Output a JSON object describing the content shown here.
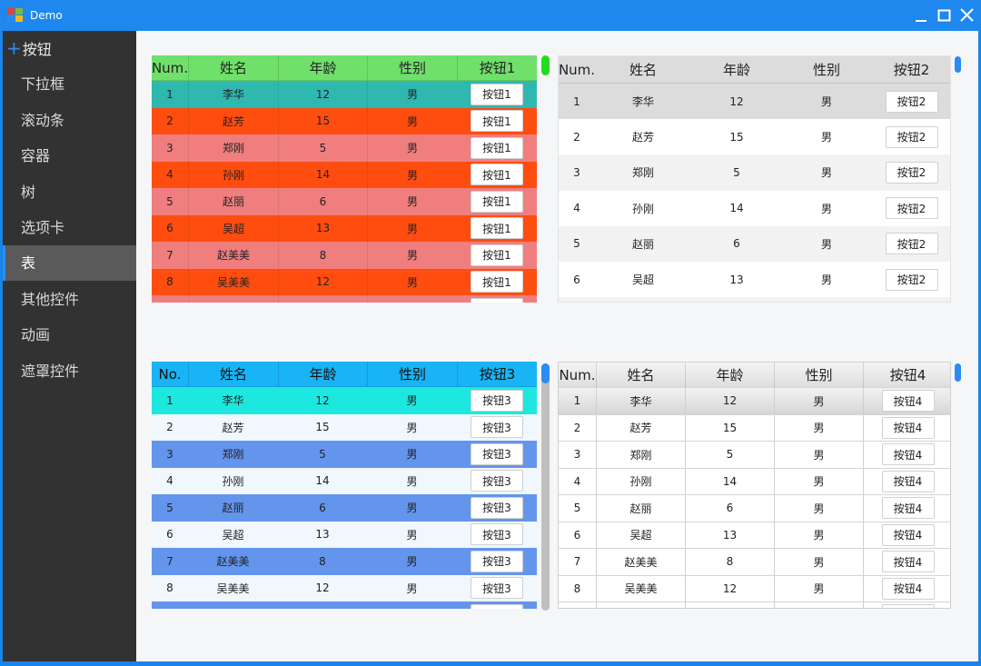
{
  "window": {
    "title": "Demo"
  },
  "sidebar": {
    "items": [
      {
        "label": "按钮",
        "head": true
      },
      {
        "label": "下拉框"
      },
      {
        "label": "滚动条"
      },
      {
        "label": "容器"
      },
      {
        "label": "树"
      },
      {
        "label": "选项卡"
      },
      {
        "label": "表",
        "active": true
      },
      {
        "label": "其他控件"
      },
      {
        "label": "动画"
      },
      {
        "label": "遮罩控件"
      }
    ]
  },
  "people": [
    {
      "num": "1",
      "name": "李华",
      "age": "12",
      "sex": "男"
    },
    {
      "num": "2",
      "name": "赵芳",
      "age": "15",
      "sex": "男"
    },
    {
      "num": "3",
      "name": "郑刚",
      "age": "5",
      "sex": "男"
    },
    {
      "num": "4",
      "name": "孙刚",
      "age": "14",
      "sex": "男"
    },
    {
      "num": "5",
      "name": "赵丽",
      "age": "6",
      "sex": "男"
    },
    {
      "num": "6",
      "name": "吴超",
      "age": "13",
      "sex": "男"
    },
    {
      "num": "7",
      "name": "赵美美",
      "age": "8",
      "sex": "男"
    },
    {
      "num": "8",
      "name": "吴美美",
      "age": "12",
      "sex": "男"
    }
  ],
  "grids": [
    {
      "id": "grid1",
      "headers": [
        "Num.",
        "姓名",
        "年龄",
        "性别",
        "按钮1"
      ],
      "button_label": "按钮1",
      "colors": {
        "header": "#6fe06a",
        "first_row": "#2fb8b0",
        "odd": "#f07e7e",
        "even": "#ff4d10",
        "scroll": "#22dd22"
      }
    },
    {
      "id": "grid2",
      "headers": [
        "Num.",
        "姓名",
        "年龄",
        "性别",
        "按钮2"
      ],
      "button_label": "按钮2",
      "colors": {
        "header": "#dcdcdc",
        "first_row": "#dcdcdc",
        "odd": "#f0f0f0",
        "even": "#ffffff",
        "scroll": "#2a8cf0"
      }
    },
    {
      "id": "grid3",
      "headers": [
        "No.",
        "姓名",
        "年龄",
        "性别",
        "按钮3"
      ],
      "button_label": "按钮3",
      "colors": {
        "header": "#18b4f5",
        "first_row": "#1de8e0",
        "odd": "#6495ed",
        "even": "#f0f7fd",
        "scroll": "#2a8cf0"
      }
    },
    {
      "id": "grid4",
      "headers": [
        "Num.",
        "姓名",
        "年龄",
        "性别",
        "按钮4"
      ],
      "button_label": "按钮4",
      "colors": {
        "header": "#e6e6e6",
        "first_row": "#d8d8d8",
        "odd": "#ffffff",
        "even": "#ffffff",
        "scroll": "#2a8cf0"
      }
    }
  ]
}
